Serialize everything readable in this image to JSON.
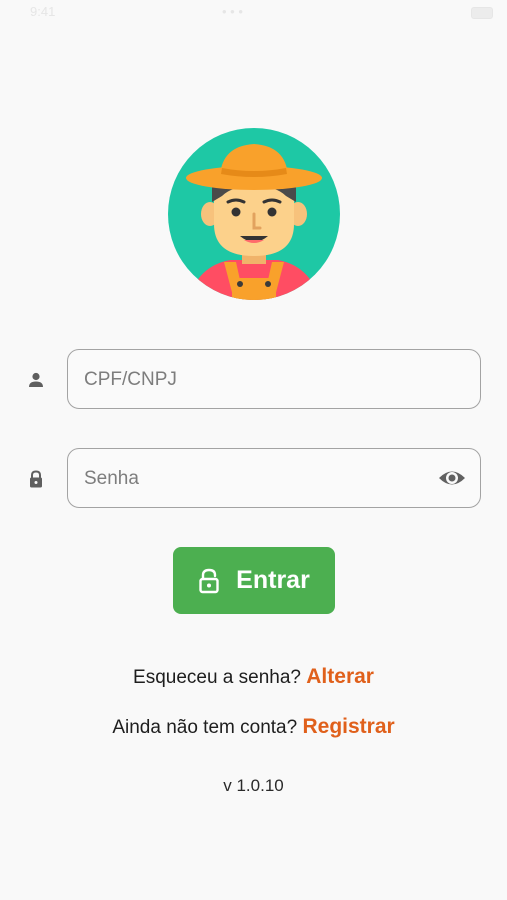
{
  "status_bar": {
    "time": "9:41",
    "center": "• • •"
  },
  "login": {
    "cpf_placeholder": "CPF/CNPJ",
    "password_placeholder": "Senha",
    "enter_label": "Entrar",
    "forgot_prefix": "Esqueceu a senha?",
    "forgot_link": "Alterar",
    "register_prefix": "Ainda não tem conta?",
    "register_link": "Registrar",
    "version": "v 1.0.10"
  },
  "colors": {
    "accent_green": "#4caf50",
    "link_orange": "#e0601b",
    "avatar_bg": "#1ec8a5"
  },
  "icons": {
    "cpf": "person-icon",
    "password": "lock-icon",
    "show_password": "eye-icon",
    "enter": "lock-open-icon"
  }
}
